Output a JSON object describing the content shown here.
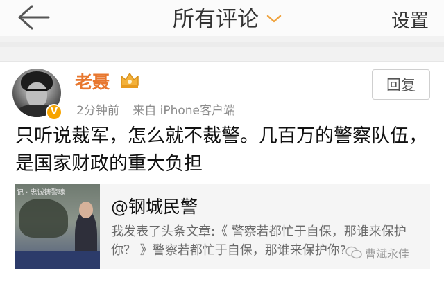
{
  "nav": {
    "title": "所有评论",
    "settings_label": "设置"
  },
  "comment": {
    "username": "老聂",
    "time": "2分钟前",
    "source": "来自 iPhone客户端",
    "reply_label": "回复",
    "text": "只听说裁军，怎么就不裁警。几百万的警察队伍，是国家财政的重大负担",
    "verify_mark": "V",
    "shared": {
      "title": "@钢城民警",
      "description": "我发表了头条文章:《 警察若都忙于自保，那谁来保护你？ 》警察若都忙于自保，那谁来保护你?",
      "thumbnail_caption": "记 · 忠诚铸警魂"
    }
  },
  "watermark": {
    "text": "曹斌永佳"
  },
  "colors": {
    "username": "#e8772e",
    "verify_badge": "#f7a400",
    "background": "#f2f2f2"
  }
}
